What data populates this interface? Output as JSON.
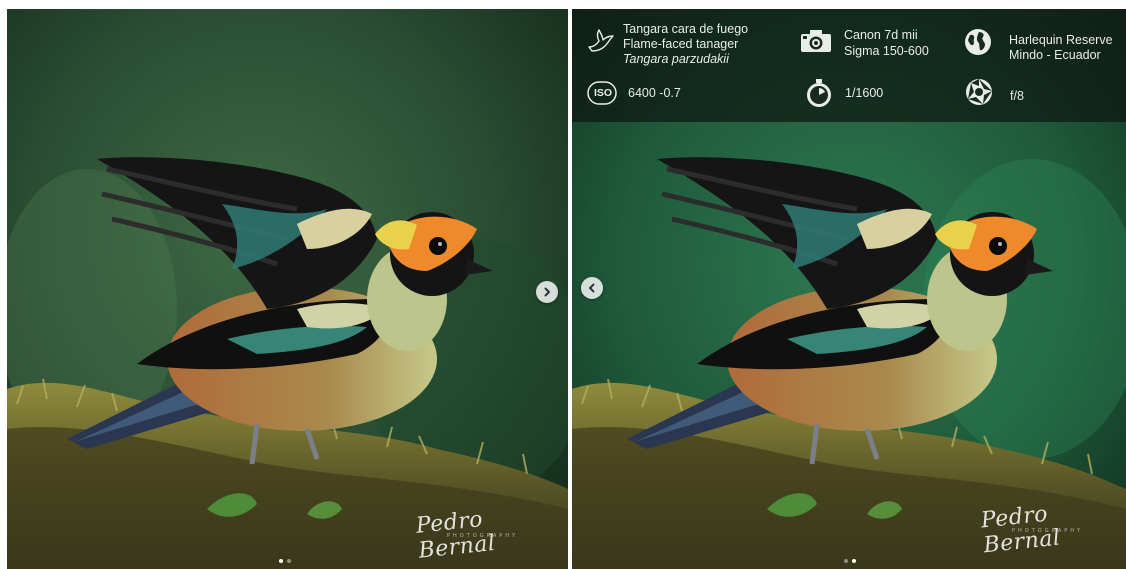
{
  "left_panel": {
    "next_button": {
      "icon": "chevron-right-icon"
    },
    "carousel_dots": [
      {
        "active": true
      },
      {
        "active": false
      }
    ],
    "signature": {
      "name": "Pedro Bernal",
      "sub": "PHOTOGRAPHY"
    }
  },
  "right_panel": {
    "prev_button": {
      "icon": "chevron-left-icon"
    },
    "carousel_dots": [
      {
        "active": false
      },
      {
        "active": true
      }
    ],
    "signature": {
      "name": "Pedro Bernal",
      "sub": "PHOTOGRAPHY"
    },
    "info": {
      "species": {
        "icon": "bird-icon",
        "spanish_name": "Tangara cara de fuego",
        "english_name": "Flame-faced tanager",
        "scientific_name": "Tangara parzudakii"
      },
      "gear": {
        "icon": "camera-icon",
        "camera": "Canon 7d mii",
        "lens": "Sigma 150-600"
      },
      "location": {
        "icon": "globe-icon",
        "place": "Harlequin Reserve",
        "region": "Mindo - Ecuador"
      },
      "iso": {
        "icon": "iso-icon",
        "icon_text": "ISO",
        "value": "6400 -0.7"
      },
      "shutter": {
        "icon": "stopwatch-icon",
        "value": "1/1600"
      },
      "aperture": {
        "icon": "aperture-icon",
        "value": "f/8"
      }
    }
  }
}
